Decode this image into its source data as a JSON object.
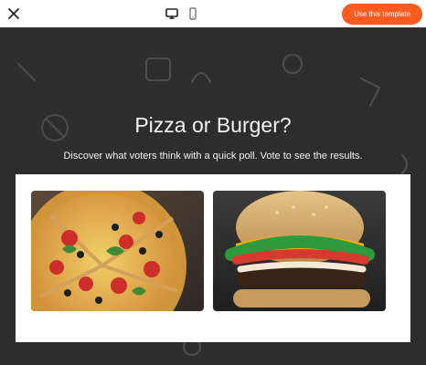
{
  "toolbar": {
    "close_icon": "close-icon",
    "desktop_icon": "desktop-icon",
    "mobile_icon": "mobile-icon",
    "use_template_label": "Use this template",
    "accent": "#ff5a1f"
  },
  "poll": {
    "title": "Pizza or Burger?",
    "subtitle": "Discover what voters think with a quick poll. Vote to see the results.",
    "options": [
      {
        "image": "pizza-image"
      },
      {
        "image": "burger-image"
      }
    ]
  }
}
